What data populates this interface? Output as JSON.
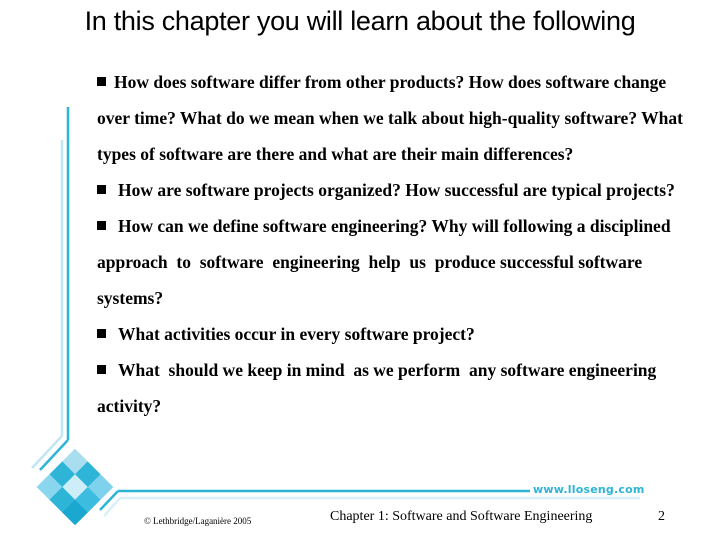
{
  "slide": {
    "title": "In this chapter you will learn about the following",
    "bullets": [
      {
        "text": "How does software differ from other products? How does software change over time? What do we mean when we talk about high-quality software? What types of software are there and what are their main differences?"
      },
      {
        "text": "How are software projects organized? How successful are typical projects?"
      },
      {
        "text": "How can we define software engineering? Why will following a disciplined approach  to  software  engineering  help  us  produce successful software systems?"
      },
      {
        "text": "What activities occur in every software project?"
      },
      {
        "text": "What  should we keep in mind  as we perform  any software engineering activity?"
      }
    ],
    "bullet_icon": "black-square"
  },
  "footer": {
    "website": "www.lloseng.com",
    "copyright": "© Lethbridge/Laganière 2005",
    "chapter": "Chapter 1: Software and Software Engineering",
    "page_number": "2"
  },
  "colors": {
    "accent": "#2eb4d6",
    "accent_light": "#bfe6f2"
  }
}
